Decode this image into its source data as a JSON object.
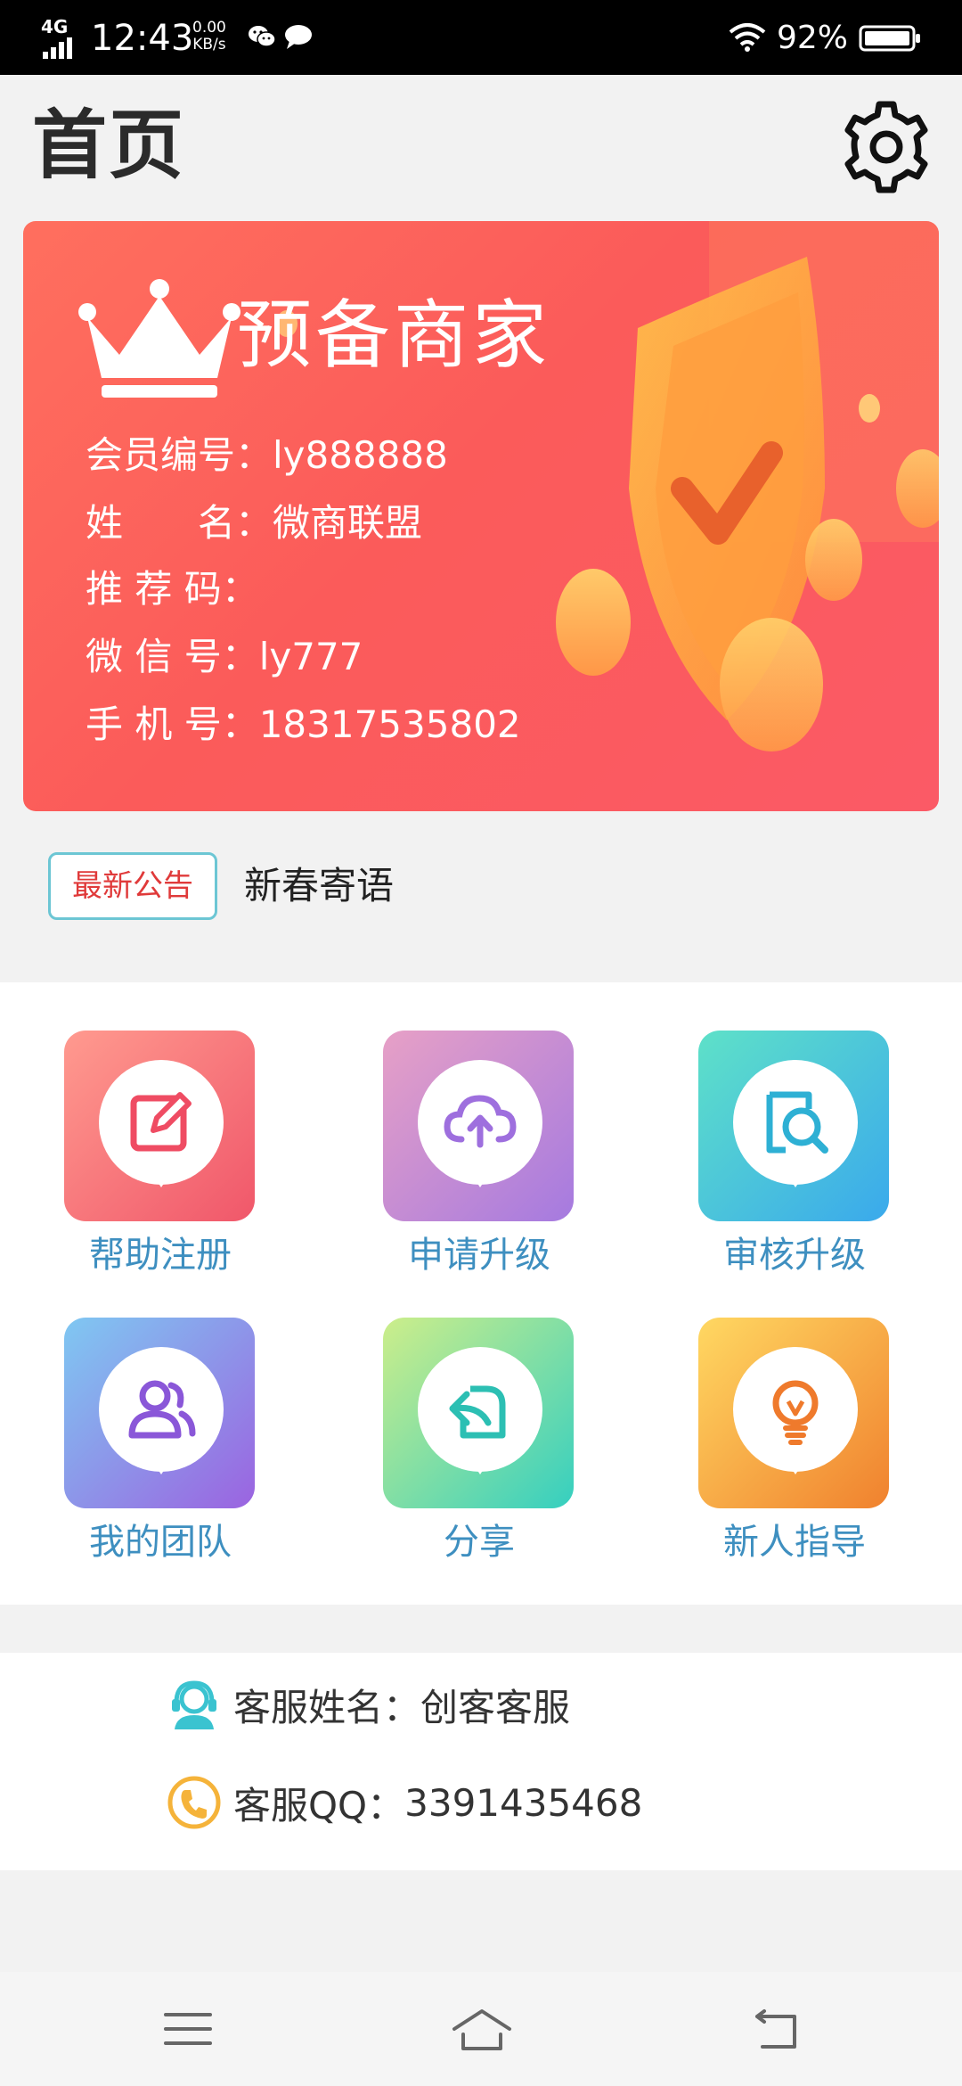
{
  "status_bar": {
    "network": "4G",
    "time": "12:43",
    "speed_value": "0.00",
    "speed_unit": "KB/s",
    "battery": "92%",
    "icons": [
      "signal-icon",
      "wechat-icon",
      "message-icon",
      "wifi-icon",
      "battery-icon"
    ]
  },
  "header": {
    "title": "首页",
    "settings_icon": "gear-icon"
  },
  "member_card": {
    "title": "预备商家",
    "crown_icon": "crown-icon",
    "rows": [
      {
        "label": "会员编号：",
        "value": "ly888888"
      },
      {
        "label": "姓　　名：",
        "value": "微商联盟"
      },
      {
        "label": "推 荐 码：",
        "value": ""
      },
      {
        "label": "微 信 号：",
        "value": "ly777"
      },
      {
        "label": "手 机 号：",
        "value": "18317535802"
      }
    ],
    "colors": {
      "start": "#ff6f5e",
      "end": "#fb5a66",
      "accent": "#ffb52e"
    }
  },
  "notice": {
    "badge": "最新公告",
    "text": "新春寄语"
  },
  "grid": {
    "items": [
      {
        "label": "帮助注册",
        "icon": "edit-icon",
        "color": "#f0576a"
      },
      {
        "label": "申请升级",
        "icon": "cloud-upload-icon",
        "color": "#a57ae0"
      },
      {
        "label": "审核升级",
        "icon": "search-document-icon",
        "color": "#2fb8dc"
      },
      {
        "label": "我的团队",
        "icon": "team-icon",
        "color": "#8a57d8"
      },
      {
        "label": "分享",
        "icon": "share-icon",
        "color": "#2fc1b7"
      },
      {
        "label": "新人指导",
        "icon": "lightbulb-icon",
        "color": "#f07f2e"
      }
    ]
  },
  "service": {
    "name_label": "客服姓名：",
    "name_value": "创客客服",
    "qq_label": "客服QQ：",
    "qq_value": "3391435468",
    "icons": [
      "headset-icon",
      "phone-icon"
    ]
  },
  "nav_bar": {
    "icons": [
      "menu-icon",
      "home-icon",
      "back-icon"
    ]
  }
}
